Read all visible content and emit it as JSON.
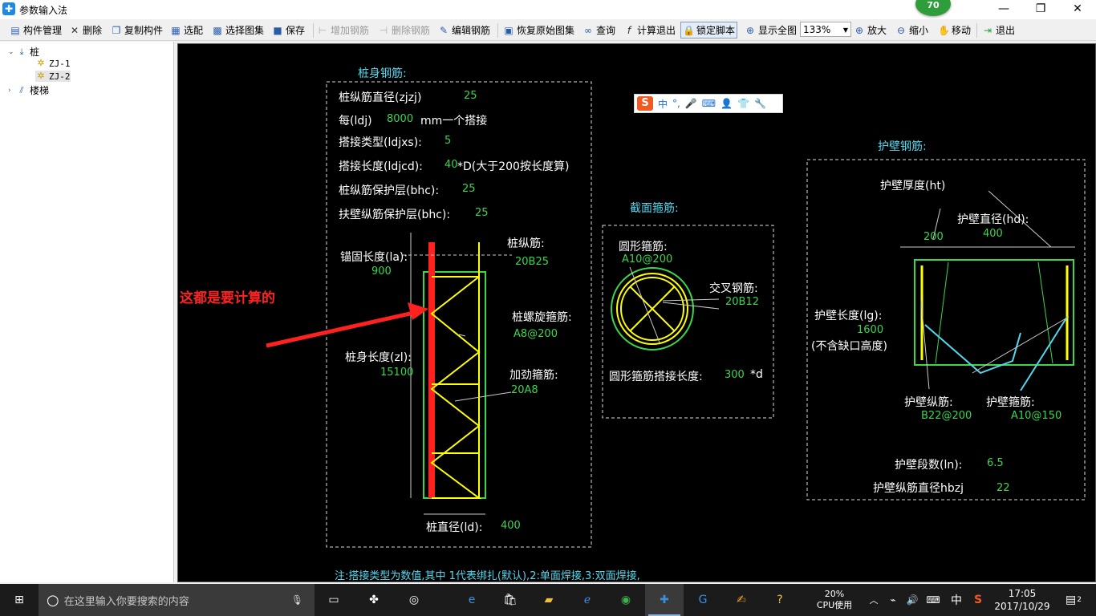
{
  "window": {
    "title": "参数输入法",
    "badge": "70",
    "minimize": "—",
    "maximize": "❐",
    "close": "✕"
  },
  "toolbar": {
    "items": [
      {
        "label": "构件管理",
        "icon": "table-icon"
      },
      {
        "label": "删除",
        "icon": "delete-x-icon"
      },
      {
        "label": "复制构件",
        "icon": "copy-icon"
      },
      {
        "label": "选配",
        "icon": "select-icon"
      },
      {
        "label": "选择图集",
        "icon": "atlas-icon"
      },
      {
        "label": "保存",
        "icon": "save-icon"
      },
      {
        "label": "增加钢筋",
        "icon": "add-rebar-icon",
        "disabled": true
      },
      {
        "label": "删除钢筋",
        "icon": "remove-rebar-icon",
        "disabled": true
      },
      {
        "label": "编辑钢筋",
        "icon": "edit-rebar-icon"
      },
      {
        "label": "恢复原始图集",
        "icon": "restore-icon"
      },
      {
        "label": "查询",
        "icon": "binoculars-icon"
      },
      {
        "label": "计算退出",
        "icon": "function-icon"
      },
      {
        "label": "锁定脚本",
        "icon": "lock-icon"
      },
      {
        "label": "显示全图",
        "icon": "fit-view-icon"
      },
      {
        "label": "放大",
        "icon": "zoom-in-icon"
      },
      {
        "label": "缩小",
        "icon": "zoom-out-icon"
      },
      {
        "label": "移动",
        "icon": "move-icon"
      },
      {
        "label": "退出",
        "icon": "exit-icon"
      }
    ],
    "zoom": "133%"
  },
  "tree": {
    "root": "桩",
    "children": [
      "ZJ-1",
      "ZJ-2"
    ],
    "selected": "ZJ-2",
    "sibling": "楼梯"
  },
  "ime": {
    "items": [
      "中",
      "°,",
      "🎤",
      "⌨",
      "👤",
      "👕",
      "🔧"
    ]
  },
  "drawing": {
    "pile_section_title": "桩身钢筋:",
    "params": [
      {
        "label": "桩纵筋直径(zjzj)",
        "value": "25"
      },
      {
        "label": "每(ldj)",
        "value": "8000",
        "suffix": "mm一个搭接"
      },
      {
        "label": "搭接类型(ldjxs):",
        "value": "5"
      },
      {
        "label": "搭接长度(ldjcd):",
        "value": "40",
        "suffix": "*D(大于200按长度算)"
      },
      {
        "label": "桩纵筋保护层(bhc):",
        "value": "25"
      },
      {
        "label": "扶壁纵筋保护层(bhc):",
        "value": "25"
      }
    ],
    "anchor_label": "锚固长度(la):",
    "anchor_value": "900",
    "pile_len_label": "桩身长度(zl):",
    "pile_len_value": "15100",
    "long_bar_label": "桩纵筋:",
    "long_bar_value": "20B25",
    "spiral_label": "桩螺旋箍筋:",
    "spiral_value": "A8@200",
    "stiff_label": "加劲箍筋:",
    "stiff_value": "20A8",
    "diameter_label": "桩直径(ld):",
    "diameter_value": "400",
    "annotation_red": "这都是要计算的",
    "section_title": "截面箍筋:",
    "circle_hoop_label": "圆形箍筋:",
    "circle_hoop_value": "A10@200",
    "cross_label": "交叉钢筋:",
    "cross_value": "20B12",
    "lap_label": "圆形箍筋搭接长度:",
    "lap_value": "300",
    "lap_suffix": "*d",
    "wall_title": "护壁钢筋:",
    "wall_thick_label": "护壁厚度(ht)",
    "wall_thick_value": "200",
    "wall_dia_label": "护壁直径(hd):",
    "wall_dia_value": "400",
    "wall_len_label": "护壁长度(lg):",
    "wall_len_value": "1600",
    "wall_len_note": "(不含缺口高度)",
    "wall_long_label": "护壁纵筋:",
    "wall_long_value": "B22@200",
    "wall_hoop_label": "护壁箍筋:",
    "wall_hoop_value": "A10@150",
    "wall_seg_label": "护壁段数(ln):",
    "wall_seg_value": "6.5",
    "wall_bar_dia_label": "护壁纵筋直径hbzj",
    "wall_bar_dia_value": "22",
    "note": "注:搭接类型为数值,其中 1代表绑扎(默认),2:单面焊接,3:双面焊接,"
  },
  "taskbar": {
    "search_placeholder": "在这里输入你要搜索的内容",
    "cpu_percent": "20%",
    "cpu_label": "CPU使用",
    "time": "17:05",
    "date": "2017/10/29",
    "ime_lang": "中",
    "notify_count": "2"
  },
  "colors": {
    "canvas": "#000000",
    "green": "#39d64e",
    "cyan": "#53d8f0",
    "yellow": "#ffff00",
    "red": "#ff2222"
  }
}
